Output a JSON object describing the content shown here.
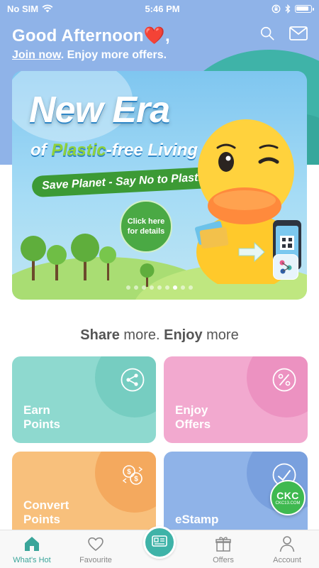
{
  "status_bar": {
    "carrier": "No SIM",
    "time": "5:46 PM",
    "battery_level": 0.9
  },
  "header": {
    "greeting": "Good Afternoon",
    "greeting_suffix": ",",
    "join_link": "Join now",
    "join_suffix": ". Enjoy more offers.",
    "icons": [
      "search-icon",
      "mail-icon"
    ]
  },
  "banner": {
    "headline": "New Era",
    "subline_prefix": "of ",
    "subline_highlight": "Plastic",
    "subline_suffix": "-free Living",
    "tagline": "Save Planet - Say No to Plastic Card !",
    "cta": "Click here for details",
    "slide_count": 9,
    "active_slide": 7
  },
  "section": {
    "title_bold1": "Share",
    "title_text1": " more. ",
    "title_bold2": "Enjoy",
    "title_text2": " more"
  },
  "tiles": [
    {
      "line1": "Earn",
      "line2": "Points",
      "icon": "share-icon"
    },
    {
      "line1": "Enjoy",
      "line2": "Offers",
      "icon": "percent-icon"
    },
    {
      "line1": "Convert",
      "line2": "Points",
      "icon": "currency-exchange-icon"
    },
    {
      "line1": "eStamp",
      "line2": "",
      "icon": "stamp-icon"
    }
  ],
  "floating_badge": {
    "big": "CKC",
    "small": "CKC13.COM"
  },
  "tabbar": {
    "items": [
      {
        "label": "What's Hot",
        "icon": "home-icon",
        "active": true
      },
      {
        "label": "Favourite",
        "icon": "heart-icon",
        "active": false
      },
      {
        "label": "",
        "icon": "scan-card-icon",
        "active": false
      },
      {
        "label": "Offers",
        "icon": "gift-icon",
        "active": false
      },
      {
        "label": "Account",
        "icon": "user-icon",
        "active": false
      }
    ]
  },
  "colors": {
    "header_bg": "#8fb3e8",
    "accent_teal": "#3fb3a8",
    "tile_earn": "#8ed9cf",
    "tile_enjoy": "#f2a9cf",
    "tile_convert": "#f8c07c",
    "tile_estamp": "#8fb3e8"
  }
}
